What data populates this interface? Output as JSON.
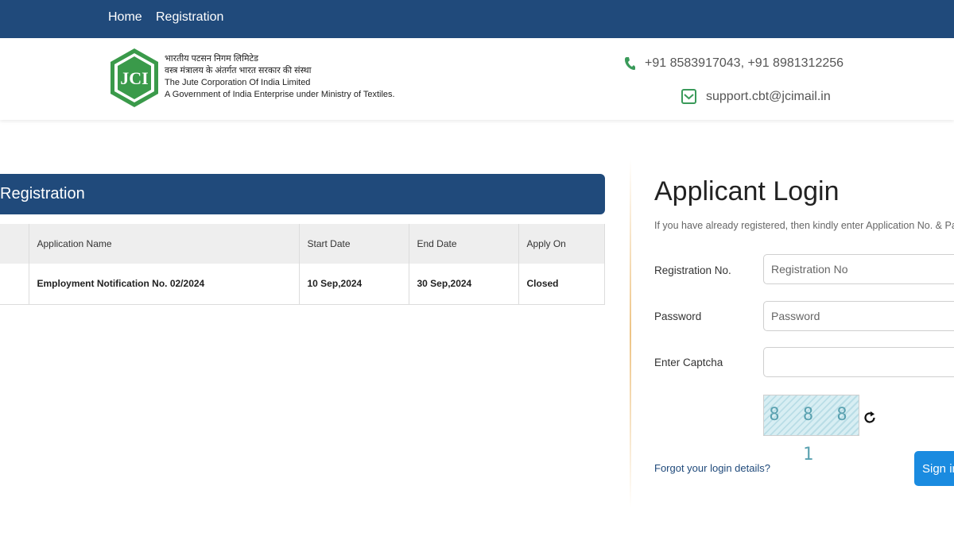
{
  "nav": {
    "items": [
      "Home",
      "Registration"
    ]
  },
  "header": {
    "logo_text": "JCI",
    "org_hindi_1": "भारतीय पटसन निगम लिमिटेड",
    "org_hindi_2": "वस्त्र मंत्रालय के अंतर्गत भारत सरकार की संस्था",
    "org_name": "The Jute Corporation Of India Limited",
    "org_tagline": "A Government of India Enterprise under Ministry of Textiles.",
    "phone": "+91 8583917043, +91 8981312256",
    "email": "support.cbt@jcimail.in",
    "phone_icon": "phone-icon",
    "email_icon": "envelope-icon"
  },
  "registration": {
    "title": "Registration",
    "columns": [
      "Application Name",
      "Start Date",
      "End Date",
      "Apply On"
    ],
    "rows": [
      [
        "Employment Notification No. 02/2024",
        "10 Sep,2024",
        "30 Sep,2024",
        "Closed"
      ]
    ]
  },
  "login": {
    "title": "Applicant Login",
    "subtitle": "If you have already registered, then kindly enter Application No. & Password.",
    "reg_label": "Registration No.",
    "reg_placeholder": "Registration No",
    "password_label": "Password",
    "password_placeholder": "Password",
    "captcha_label": "Enter Captcha",
    "captcha_value": "8881",
    "captcha_display": "8 8 8 1",
    "forgot": "Forgot your login details?",
    "signin": "Sign in"
  },
  "colors": {
    "primary": "#204a7b",
    "accent": "#1a8be0",
    "logo_green": "#3a9a4a"
  }
}
